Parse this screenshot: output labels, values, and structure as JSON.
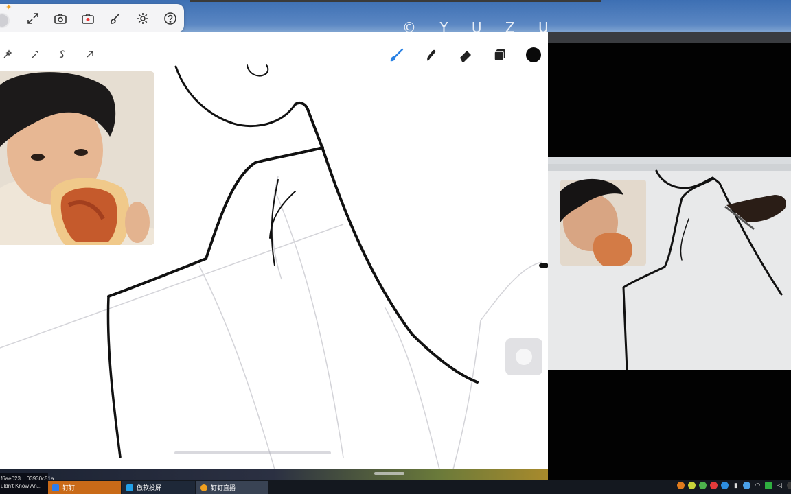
{
  "desktop": {
    "watermark": "© Y U Z U"
  },
  "tool_popup": {
    "icons": [
      "fullscreen-icon",
      "camera-icon",
      "record-icon",
      "brush-settings-icon",
      "gear-icon",
      "help-icon"
    ]
  },
  "procreate": {
    "left_tools": [
      "adjust-wand-icon",
      "magic-wand-icon",
      "selection-s-icon",
      "transform-arrow-icon"
    ],
    "right_tools": [
      "brush-icon",
      "smudge-icon",
      "eraser-icon",
      "layers-icon"
    ],
    "current_color": "#0a0a0a",
    "accent_color": "#2a82e4"
  },
  "taskbar": {
    "info_line1": "f6ae023... 03930c51a...",
    "info_line2": "uldn't Know An...",
    "buttons": [
      {
        "label": "钉钉",
        "color": "#c96a18"
      },
      {
        "label": "傲软投屏",
        "color": "#1e2838"
      },
      {
        "label": "钉钉直播",
        "color": "#394354"
      }
    ]
  }
}
